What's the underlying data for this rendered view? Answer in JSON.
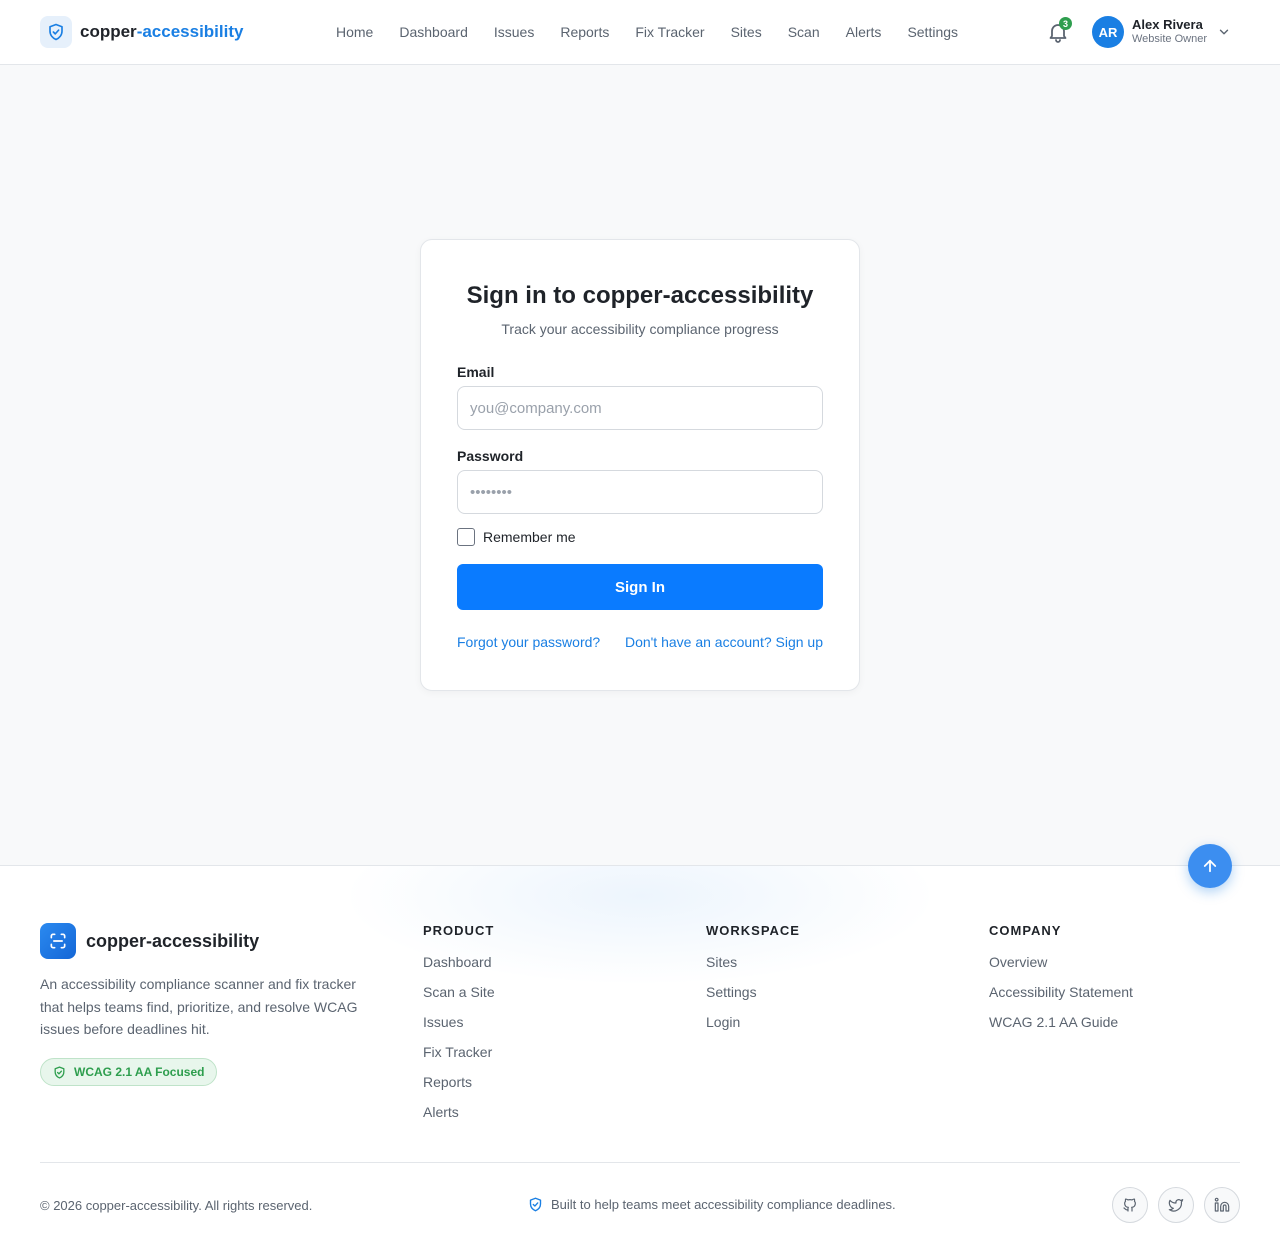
{
  "header": {
    "brand_main": "copper",
    "brand_accent": "-accessibility",
    "nav": [
      {
        "label": "Home"
      },
      {
        "label": "Dashboard"
      },
      {
        "label": "Issues"
      },
      {
        "label": "Reports"
      },
      {
        "label": "Fix Tracker"
      },
      {
        "label": "Sites"
      },
      {
        "label": "Scan"
      },
      {
        "label": "Alerts"
      },
      {
        "label": "Settings"
      }
    ],
    "notification_count": "3",
    "user": {
      "initials": "AR",
      "name": "Alex Rivera",
      "role": "Website Owner"
    }
  },
  "login": {
    "title": "Sign in to copper-accessibility",
    "subtitle": "Track your accessibility compliance progress",
    "email_label": "Email",
    "email_placeholder": "you@company.com",
    "password_label": "Password",
    "password_placeholder": "••••••••",
    "remember_label": "Remember me",
    "submit_label": "Sign In",
    "forgot_link": "Forgot your password?",
    "signup_link": "Don't have an account? Sign up"
  },
  "footer": {
    "brand": "copper-accessibility",
    "description": "An accessibility compliance scanner and fix tracker that helps teams find, prioritize, and resolve WCAG issues before deadlines hit.",
    "badge": "WCAG 2.1 AA Focused",
    "columns": [
      {
        "title": "PRODUCT",
        "links": [
          "Dashboard",
          "Scan a Site",
          "Issues",
          "Fix Tracker",
          "Reports",
          "Alerts"
        ]
      },
      {
        "title": "WORKSPACE",
        "links": [
          "Sites",
          "Settings",
          "Login"
        ]
      },
      {
        "title": "COMPANY",
        "links": [
          "Overview",
          "Accessibility Statement",
          "WCAG 2.1 AA Guide"
        ]
      }
    ],
    "copyright": "© 2026 copper-accessibility. All rights reserved.",
    "built_text": "Built to help teams meet accessibility compliance deadlines.",
    "social_icons": [
      "github-icon",
      "twitter-icon",
      "linkedin-icon"
    ]
  },
  "colors": {
    "primary": "#0a7bff",
    "accent": "#1a7fe3",
    "success": "#2e9e4e",
    "background": "#f8f9fa"
  }
}
